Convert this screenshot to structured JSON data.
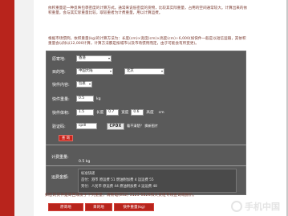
{
  "intro": {
    "paragraph1": "依积重量是一种反映包裹密度的计算方式。通常来说低密度的货物，比较其实际重量，占用的空间通常较大。计算出来的依积重量，会与其实际重量比较，取较重者为计费重量，用以计算运费。",
    "paragraph2": "根据市场惯例，依积重量(kg)的计算方法为：长度(cm)×宽度(cm)×高度(cm)÷6,000(如快件一般是以短信运输，其依积重量会以除以12,000计算，计算方法都是按城市以及市场惯例而定，由于可能会有所变更)。"
  },
  "form": {
    "origin_label": "原寄地:",
    "origin_value": "香港",
    "destination_label": "目的地:",
    "destination_country": "中国大陆",
    "destination_city": "北京",
    "content_label": "快件内容:",
    "content_value": "包裹",
    "weight_label": "快件重量:",
    "weight_value": "0.5",
    "weight_unit": "kg",
    "size_label": "快件体积:",
    "length_label": "长度",
    "length_value": "1.5",
    "width_label": "宽度",
    "width_value": "0.7",
    "height_label": "高度",
    "height_value": "0.6",
    "dimension_unit": "cm",
    "captcha_label": "验证码:",
    "captcha_input": "cpdl",
    "captcha_image_text": "CPDX",
    "captcha_refresh": "看不清楚？ 换新图片",
    "query_button": "查 询"
  },
  "result": {
    "weight_label": "计费重量:",
    "weight_value": "0.5 kg",
    "fee_label": "运费金额:",
    "service_name": "标准快递",
    "line1": "首付：港币 原运费 51 燃油附加费 4 运运费 55",
    "line2": "到付：人民币 原运费 44 燃油附加费 4 运运费 48"
  },
  "note": "如您的货件是寄回或发于下列重量，请致电(852) 3123 6826和大货组专线查询或报价。",
  "tabs": [
    "原寄地",
    "目的地",
    "快件重量(kg)"
  ],
  "watermark": "手机中国"
}
